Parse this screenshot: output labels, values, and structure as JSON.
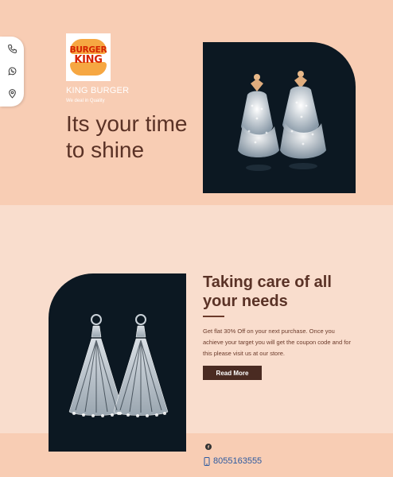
{
  "sidebar": {
    "icons": [
      "phone-icon",
      "whatsapp-icon",
      "location-pin-icon"
    ]
  },
  "brand": {
    "logo_text_line1": "BURGER",
    "logo_text_line2": "KING",
    "name": "KING BURGER",
    "tagline": "We deal in Quality"
  },
  "hero": {
    "title": "Its your time to shine"
  },
  "section": {
    "title": "Taking care of all your needs",
    "description": "Get flat 30% Off on your next purchase. Once you achieve your target you will get the coupon code and for this please visit us at our store.",
    "button_label": "Read More"
  },
  "footer": {
    "social_icon": "facebook-icon",
    "phone": "8055163555"
  },
  "colors": {
    "hero_bg": "#f8cdb4",
    "section_bg": "#f9ddcd",
    "image_bg": "#0c1822",
    "heading": "#5a3226",
    "button_bg": "#4a2b22",
    "logo_red": "#d62300",
    "logo_bun": "#f6a742",
    "phone_link": "#2d5aa0"
  }
}
